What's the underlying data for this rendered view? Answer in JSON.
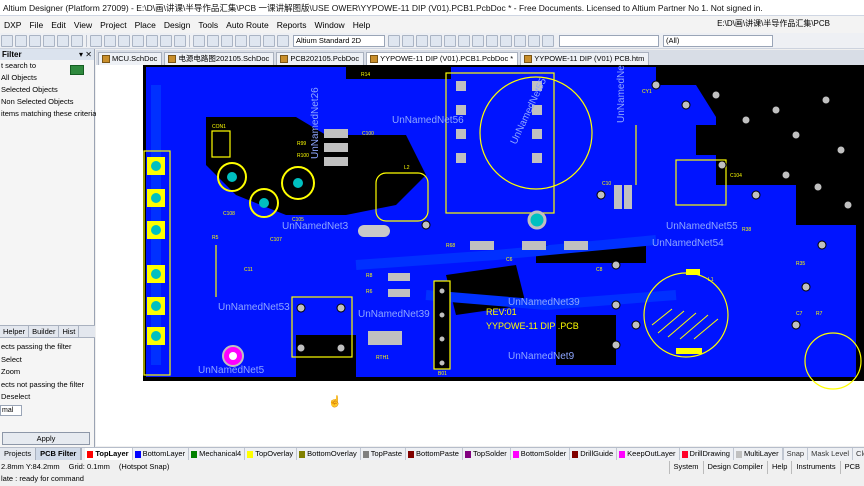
{
  "window": {
    "title": "Altium Designer (Platform 27009) - E:\\D\\画\\讲课\\半导作品汇集\\PCB 一课讲解图版\\USE OWER\\YYPOWE-11 DIP (V01).PCB1.PcbDoc * - Free Documents. Licensed to Altium Partner No 1. Not signed in."
  },
  "menu": {
    "items": [
      "DXP",
      "File",
      "Edit",
      "View",
      "Project",
      "Place",
      "Design",
      "Tools",
      "Auto Route",
      "Reports",
      "Window",
      "Help"
    ],
    "path": "E:\\D\\画\\讲课\\半导作品汇集\\PCB"
  },
  "toolbar": {
    "standard": "Altium Standard 2D",
    "filter_all": "(All)"
  },
  "tabs": [
    {
      "label": "MCU.SchDoc",
      "active": false
    },
    {
      "label": "电源电路图202105.SchDoc",
      "active": false
    },
    {
      "label": "PCB202105.PcbDoc",
      "active": false
    },
    {
      "label": "YYPOWE-11 DIP (V01).PCB1.PcbDoc *",
      "active": true
    },
    {
      "label": "YYPOWE-11 DIP (V01) PCB.htm",
      "active": false
    }
  ],
  "left_panel": {
    "title": "Filter",
    "lines": [
      "t search to",
      "All Objects",
      "Selected Objects",
      "Non Selected Objects",
      "",
      "items matching these criteria:"
    ],
    "tabs": [
      "Helper",
      "Builder",
      "Hist"
    ],
    "lower_lines": [
      "ects passing the filter",
      "Select",
      "Zoom",
      "ects not passing the filter",
      "Deselect",
      "mal"
    ],
    "apply_label": "Apply"
  },
  "board": {
    "nets": [
      "UnNamedNet56",
      "UnNamedNet26",
      "UnNamedNet3",
      "UnNamedNet55",
      "UnNamedNet55",
      "UnNamedNet54",
      "UnNamedNet53",
      "UnNamedNet39",
      "UnNamedNet39",
      "UnNamedNet9",
      "UnNamedNet5",
      "UnNamedNet5"
    ],
    "rev": "REV:01",
    "board_name": "YYPOWE-11 DIP .PCB",
    "designators": [
      "R14",
      "CON1",
      "C100",
      "R99",
      "R100",
      "C108",
      "C107",
      "C105",
      "L2",
      "R5",
      "C11",
      "L1",
      "C6",
      "R68",
      "C8",
      "R8",
      "R6",
      "RTH1",
      "B01",
      "CY1",
      "C104",
      "C10",
      "R38",
      "R35",
      "C7",
      "R7"
    ]
  },
  "layer_tabs": [
    {
      "label": "TopLayer",
      "color": "#ff0000",
      "active": true
    },
    {
      "label": "BottomLayer",
      "color": "#0000ff",
      "active": false
    },
    {
      "label": "Mechanical4",
      "color": "#008000",
      "active": false
    },
    {
      "label": "TopOverlay",
      "color": "#ffff00",
      "active": false
    },
    {
      "label": "BottomOverlay",
      "color": "#808000",
      "active": false
    },
    {
      "label": "TopPaste",
      "color": "#808080",
      "active": false
    },
    {
      "label": "BottomPaste",
      "color": "#800000",
      "active": false
    },
    {
      "label": "TopSolder",
      "color": "#800080",
      "active": false
    },
    {
      "label": "BottomSolder",
      "color": "#ff00ff",
      "active": false
    },
    {
      "label": "DrillGuide",
      "color": "#800000",
      "active": false
    },
    {
      "label": "KeepOutLayer",
      "color": "#ff00ff",
      "active": false
    },
    {
      "label": "DrillDrawing",
      "color": "#ff002a",
      "active": false
    },
    {
      "label": "MultiLayer",
      "color": "#c0c0c0",
      "active": false
    }
  ],
  "panel_bottom_tabs": [
    "Projects",
    "PCB Filter"
  ],
  "layer_bar_right": [
    "Snap",
    "Mask Level",
    "Clear"
  ],
  "status": {
    "coords": "2.8mm Y:84.2mm",
    "grid": "Grid: 0.1mm",
    "snap": "(Hotspot Snap)",
    "state": "late : ready for command",
    "right_items": [
      "System",
      "Design Compiler",
      "Help",
      "Instruments",
      "PCB"
    ]
  },
  "colors": {
    "board_bg": "#000000",
    "bottom_copper": "#0000ff",
    "overlay": "#ffff00",
    "net_label": "#9fb4ff",
    "pad": "#c0c0c0",
    "via_hole": "#00d0d0",
    "selection": "#ff00ff"
  }
}
